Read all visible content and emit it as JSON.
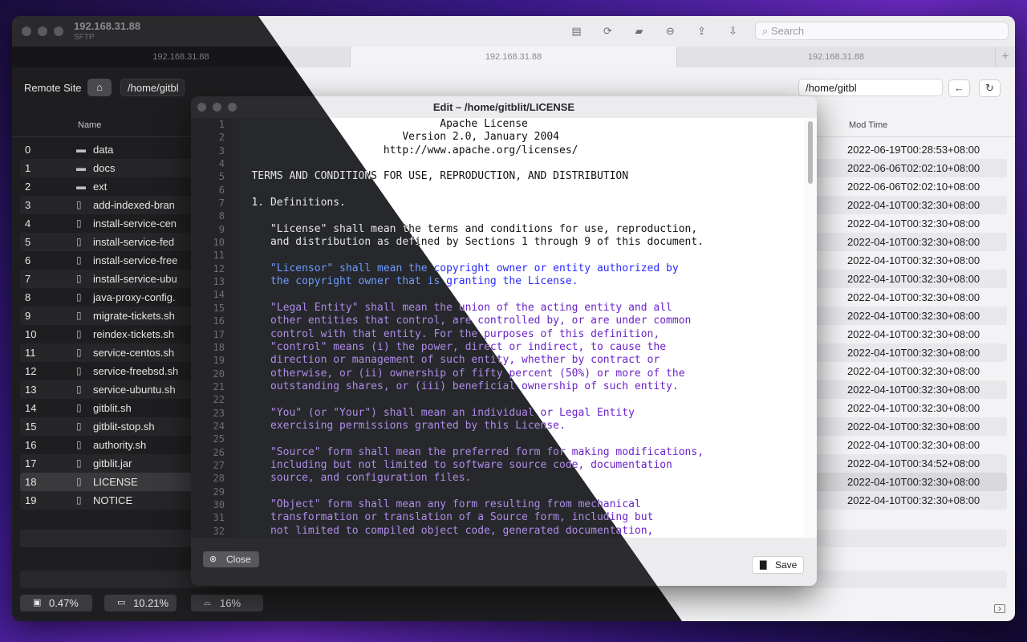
{
  "window": {
    "host": "192.168.31.88",
    "protocol": "SFTP"
  },
  "tabs": [
    "192.168.31.88",
    "192.168.31.88",
    "192.168.31.88"
  ],
  "toolbar": {
    "search_placeholder": "Search"
  },
  "remote": {
    "label": "Remote Site",
    "path": "/home/gitbl"
  },
  "columns": {
    "name": "Name",
    "mod_time": "Mod Time"
  },
  "files": [
    {
      "idx": "0",
      "type": "folder",
      "name": "data",
      "mtime": "2022-06-19T00:28:53+08:00"
    },
    {
      "idx": "1",
      "type": "folder",
      "name": "docs",
      "mtime": "2022-06-06T02:02:10+08:00"
    },
    {
      "idx": "2",
      "type": "folder",
      "name": "ext",
      "mtime": "2022-06-06T02:02:10+08:00"
    },
    {
      "idx": "3",
      "type": "file",
      "name": "add-indexed-bran",
      "mtime": "2022-04-10T00:32:30+08:00"
    },
    {
      "idx": "4",
      "type": "file",
      "name": "install-service-cen",
      "mtime": "2022-04-10T00:32:30+08:00"
    },
    {
      "idx": "5",
      "type": "file",
      "name": "install-service-fed",
      "mtime": "2022-04-10T00:32:30+08:00"
    },
    {
      "idx": "6",
      "type": "file",
      "name": "install-service-free",
      "mtime": "2022-04-10T00:32:30+08:00"
    },
    {
      "idx": "7",
      "type": "file",
      "name": "install-service-ubu",
      "mtime": "2022-04-10T00:32:30+08:00"
    },
    {
      "idx": "8",
      "type": "file",
      "name": "java-proxy-config.",
      "mtime": "2022-04-10T00:32:30+08:00"
    },
    {
      "idx": "9",
      "type": "file",
      "name": "migrate-tickets.sh",
      "mtime": "2022-04-10T00:32:30+08:00"
    },
    {
      "idx": "10",
      "type": "file",
      "name": "reindex-tickets.sh",
      "mtime": "2022-04-10T00:32:30+08:00"
    },
    {
      "idx": "11",
      "type": "file",
      "name": "service-centos.sh",
      "mtime": "2022-04-10T00:32:30+08:00"
    },
    {
      "idx": "12",
      "type": "file",
      "name": "service-freebsd.sh",
      "mtime": "2022-04-10T00:32:30+08:00"
    },
    {
      "idx": "13",
      "type": "file",
      "name": "service-ubuntu.sh",
      "mtime": "2022-04-10T00:32:30+08:00"
    },
    {
      "idx": "14",
      "type": "file",
      "name": "gitblit.sh",
      "mtime": "2022-04-10T00:32:30+08:00"
    },
    {
      "idx": "15",
      "type": "file",
      "name": "gitblit-stop.sh",
      "mtime": "2022-04-10T00:32:30+08:00"
    },
    {
      "idx": "16",
      "type": "file",
      "name": "authority.sh",
      "mtime": "2022-04-10T00:32:30+08:00"
    },
    {
      "idx": "17",
      "type": "file",
      "name": "gitblit.jar",
      "mtime": "2022-04-10T00:34:52+08:00"
    },
    {
      "idx": "18",
      "type": "file",
      "name": "LICENSE",
      "mtime": "2022-04-10T00:32:30+08:00",
      "selected": true
    },
    {
      "idx": "19",
      "type": "file",
      "name": "NOTICE",
      "mtime": "2022-04-10T00:32:30+08:00"
    }
  ],
  "status": {
    "cpu": "0.47%",
    "memory": "10.21%",
    "disk": "16%"
  },
  "editor": {
    "title": "Edit – /home/gitblit/LICENSE",
    "close_label": "Close",
    "save_label": "Save",
    "lines": [
      {
        "t": "                                 Apache License",
        "c": ""
      },
      {
        "t": "                           Version 2.0, January 2004",
        "c": ""
      },
      {
        "t": "                        http://www.apache.org/licenses/",
        "c": ""
      },
      {
        "t": "",
        "c": ""
      },
      {
        "t": "   TERMS AND CONDITIONS FOR USE, REPRODUCTION, AND DISTRIBUTION",
        "c": ""
      },
      {
        "t": "",
        "c": ""
      },
      {
        "t": "   1. Definitions.",
        "c": ""
      },
      {
        "t": "",
        "c": ""
      },
      {
        "t": "      \"License\" shall mean the terms and conditions for use, reproduction,",
        "c": ""
      },
      {
        "t": "      and distribution as defined by Sections 1 through 9 of this document.",
        "c": ""
      },
      {
        "t": "",
        "c": ""
      },
      {
        "t": "      \"Licensor\" shall mean the copyright owner or entity authorized by",
        "c": "blue"
      },
      {
        "t": "      the copyright owner that is granting the License.",
        "c": "blue"
      },
      {
        "t": "",
        "c": ""
      },
      {
        "t": "      \"Legal Entity\" shall mean the union of the acting entity and all",
        "c": "purple"
      },
      {
        "t": "      other entities that control, are controlled by, or are under common",
        "c": "purple"
      },
      {
        "t": "      control with that entity. For the purposes of this definition,",
        "c": "purple"
      },
      {
        "t": "      \"control\" means (i) the power, direct or indirect, to cause the",
        "c": "purple"
      },
      {
        "t": "      direction or management of such entity, whether by contract or",
        "c": "purple"
      },
      {
        "t": "      otherwise, or (ii) ownership of fifty percent (50%) or more of the",
        "c": "purple"
      },
      {
        "t": "      outstanding shares, or (iii) beneficial ownership of such entity.",
        "c": "purple"
      },
      {
        "t": "",
        "c": ""
      },
      {
        "t": "      \"You\" (or \"Your\") shall mean an individual or Legal Entity",
        "c": "purple"
      },
      {
        "t": "      exercising permissions granted by this License.",
        "c": "purple"
      },
      {
        "t": "",
        "c": ""
      },
      {
        "t": "      \"Source\" form shall mean the preferred form for making modifications,",
        "c": "purple"
      },
      {
        "t": "      including but not limited to software source code, documentation",
        "c": "purple"
      },
      {
        "t": "      source, and configuration files.",
        "c": "purple"
      },
      {
        "t": "",
        "c": ""
      },
      {
        "t": "      \"Object\" form shall mean any form resulting from mechanical",
        "c": "purple"
      },
      {
        "t": "      transformation or translation of a Source form, including but",
        "c": "purple"
      },
      {
        "t": "      not limited to compiled object code, generated documentation,",
        "c": "purple"
      }
    ]
  }
}
